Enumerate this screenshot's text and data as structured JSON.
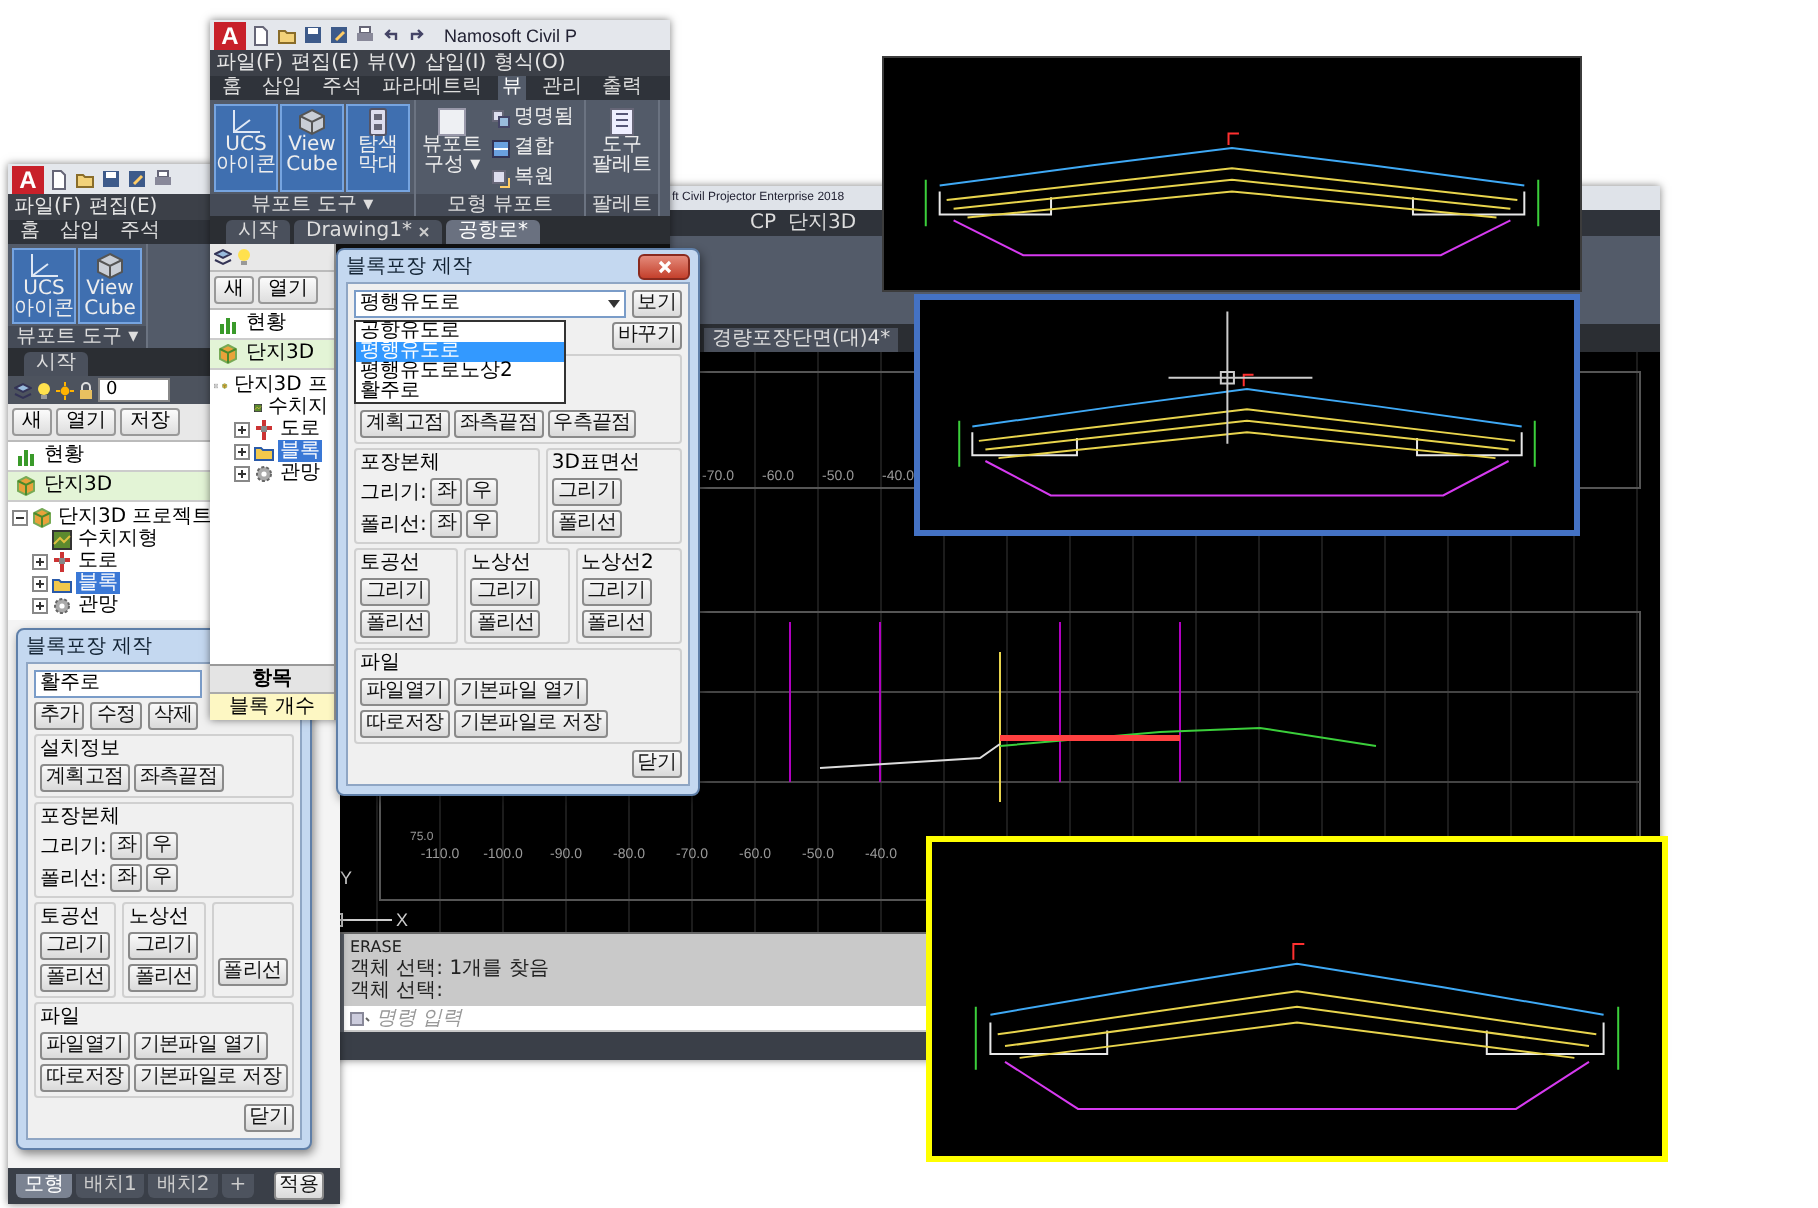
{
  "cad_window": {
    "title": "ft Civil Projector Enterprise 2018",
    "ribbon_tabs": [
      "CP",
      "단지3D"
    ],
    "file_tab": "경량포장단면(대)4*",
    "top_scale_labels": [
      "-70.0",
      "-60.0",
      "-50.0",
      "-40.0"
    ],
    "bottom_scale_labels": [
      "-110.0",
      "-100.0",
      "-90.0",
      "-80.0",
      "-70.0",
      "-60.0",
      "-50.0",
      "-40.0"
    ],
    "elevation": "75.0",
    "ucs": [
      "Y",
      "X"
    ],
    "command_history": [
      "ERASE",
      "객체 선택: 1개를 찾음",
      "객체 선택:"
    ],
    "command_placeholder": "명령 입력"
  },
  "left_window": {
    "logo": "A",
    "menu": [
      "파일(F)",
      "편집(E)"
    ],
    "tabs": [
      {
        "label": "홈",
        "selected": false
      },
      {
        "label": "삽입",
        "selected": false
      },
      {
        "label": "주석",
        "selected": false
      }
    ],
    "ribbon_panels": [
      {
        "label": "뷰포트 도구 ▾",
        "buttons": [
          {
            "kind": "ucs",
            "label": "UCS 아이콘",
            "selected": true
          },
          {
            "kind": "viewcube",
            "label": "View Cube",
            "selected": true
          }
        ]
      }
    ],
    "doc_tab": "시작",
    "layer": "0",
    "toolbar": [
      "새",
      "열기",
      "저장"
    ],
    "status": "현황",
    "project": "단지3D",
    "tree": [
      {
        "kind": "project",
        "label": "단지3D 프로젝트",
        "expanded": true,
        "selected": false,
        "children": [
          {
            "kind": "terrain",
            "label": "수치지형",
            "selected": false
          },
          {
            "kind": "road",
            "label": "도로",
            "expanded": false,
            "selected": false
          },
          {
            "kind": "block",
            "label": "블록",
            "expanded": false,
            "selected": true
          },
          {
            "kind": "network",
            "label": "관망",
            "expanded": false,
            "selected": false
          }
        ]
      }
    ],
    "dialog": {
      "title": "블록포장 제작",
      "dropdown": {
        "value": "활주로"
      },
      "edit_buttons": [
        "추가",
        "수정",
        "삭제"
      ],
      "sections": [
        {
          "groups": [
            {
              "title": "설치정보",
              "rows": [
                {
                  "buttons": [
                    "계획고점",
                    "좌측끝점"
                  ]
                }
              ]
            }
          ]
        },
        {
          "groups": [
            {
              "title": "포장본체",
              "rows": [
                {
                  "label": "그리기:",
                  "buttons": [
                    "좌",
                    "우"
                  ]
                },
                {
                  "label": "폴리선:",
                  "buttons": [
                    "좌",
                    "우"
                  ]
                }
              ]
            }
          ]
        },
        {
          "groups": [
            {
              "title": "토공선",
              "rows": [
                {
                  "buttons": [
                    "그리기"
                  ]
                },
                {
                  "buttons": [
                    "폴리선"
                  ]
                }
              ]
            },
            {
              "title": "노상선",
              "rows": [
                {
                  "buttons": [
                    "그리기"
                  ]
                },
                {
                  "buttons": [
                    "폴리선"
                  ]
                }
              ]
            },
            {
              "rows": [
                {
                  "buttons": [
                    "폴리선"
                  ]
                }
              ]
            }
          ]
        },
        {
          "groups": [
            {
              "title": "파일",
              "rows": [
                {
                  "buttons": [
                    "파일열기",
                    "기본파일 열기"
                  ]
                },
                {
                  "buttons": [
                    "따로저장",
                    "기본파일로 저장"
                  ]
                }
              ]
            }
          ]
        }
      ],
      "close": "닫기"
    },
    "apply": "적용",
    "layout_tabs": [
      {
        "label": "모형",
        "selected": true
      },
      {
        "label": "배치1",
        "selected": false
      },
      {
        "label": "배치2",
        "selected": false
      },
      {
        "label": "+",
        "selected": false
      }
    ]
  },
  "main_window": {
    "logo": "A",
    "title": "Namosoft Civil P",
    "menu": [
      "파일(F)",
      "편집(E)",
      "뷰(V)",
      "삽입(I)",
      "형식(O)"
    ],
    "tabs": [
      {
        "label": "홈",
        "selected": false
      },
      {
        "label": "삽입",
        "selected": false
      },
      {
        "label": "주석",
        "selected": false
      },
      {
        "label": "파라메트릭",
        "selected": false
      },
      {
        "label": "뷰",
        "selected": true
      },
      {
        "label": "관리",
        "selected": false
      },
      {
        "label": "출력",
        "selected": false
      }
    ],
    "ribbon_panels": [
      {
        "label": "뷰포트 도구 ▾",
        "buttons": [
          {
            "kind": "ucs",
            "label": "UCS 아이콘",
            "selected": true
          },
          {
            "kind": "viewcube",
            "label": "View Cube",
            "selected": true
          },
          {
            "kind": "navbar",
            "label": "탐색 막대",
            "selected": true
          }
        ]
      },
      {
        "label": "모형 뷰포트",
        "buttons": [
          {
            "kind": "viewport",
            "label": "뷰포트 구성 ▾",
            "selected": false
          },
          {
            "kind": "named",
            "label": "명명됨",
            "selected": false
          },
          {
            "kind": "join",
            "label": "결합",
            "selected": false
          },
          {
            "kind": "restore",
            "label": "복원",
            "selected": false
          }
        ]
      },
      {
        "label": "팔레트",
        "buttons": [
          {
            "kind": "palette",
            "label": "도구 팔레트",
            "selected": false
          }
        ]
      }
    ],
    "doc_tabs": [
      {
        "label": "시작",
        "selected": false,
        "closable": false
      },
      {
        "label": "Drawing1*",
        "selected": false,
        "closable": true
      },
      {
        "label": "공항로*",
        "selected": true,
        "closable": false
      }
    ],
    "toolbar": [
      "새",
      "열기"
    ],
    "status": "현황",
    "project": "단지3D",
    "tree": [
      {
        "kind": "project",
        "label": "단지3D 프",
        "expanded": true,
        "selected": false,
        "children": [
          {
            "kind": "terrain",
            "label": "수치지",
            "selected": false
          },
          {
            "kind": "road",
            "label": "도로",
            "expanded": false,
            "selected": false
          },
          {
            "kind": "block",
            "label": "블록",
            "expanded": false,
            "selected": true
          },
          {
            "kind": "network",
            "label": "관망",
            "expanded": false,
            "selected": false
          }
        ]
      }
    ],
    "table": {
      "header": "항목",
      "cell": "블록 개수"
    }
  },
  "dialog": {
    "title": "블록포장 제작",
    "dropdown": {
      "value": "평행유도로",
      "options": [
        {
          "label": "공항유도로",
          "selected": false
        },
        {
          "label": "평행유도로",
          "selected": true
        },
        {
          "label": "평행유도로노상2",
          "selected": false
        },
        {
          "label": "활주로",
          "selected": false
        }
      ]
    },
    "view_button": "보기",
    "edit_buttons": [
      "바꾸기"
    ],
    "sections": [
      {
        "groups": [
          {
            "rows": [
              {
                "buttons": [
                  "계획고점",
                  "좌측끝점",
                  "우측끝점"
                ]
              }
            ]
          }
        ]
      },
      {
        "groups": [
          {
            "title": "포장본체",
            "rows": [
              {
                "label": "그리기:",
                "buttons": [
                  "좌",
                  "우"
                ]
              },
              {
                "label": "폴리선:",
                "buttons": [
                  "좌",
                  "우"
                ]
              }
            ]
          },
          {
            "title": "3D표면선",
            "rows": [
              {
                "buttons": [
                  "그리기"
                ]
              },
              {
                "buttons": [
                  "폴리선"
                ]
              }
            ]
          }
        ]
      },
      {
        "groups": [
          {
            "title": "토공선",
            "rows": [
              {
                "buttons": [
                  "그리기"
                ]
              },
              {
                "buttons": [
                  "폴리선"
                ]
              }
            ]
          },
          {
            "title": "노상선",
            "rows": [
              {
                "buttons": [
                  "그리기"
                ]
              },
              {
                "buttons": [
                  "폴리선"
                ]
              }
            ]
          },
          {
            "title": "노상선2",
            "rows": [
              {
                "buttons": [
                  "그리기"
                ]
              },
              {
                "buttons": [
                  "폴리선"
                ]
              }
            ]
          }
        ]
      },
      {
        "groups": [
          {
            "title": "파일",
            "rows": [
              {
                "buttons": [
                  "파일열기",
                  "기본파일 열기"
                ]
              },
              {
                "buttons": [
                  "따로저장",
                  "기본파일로 저장"
                ]
              }
            ]
          }
        ]
      }
    ],
    "close": "닫기"
  },
  "images": [
    {
      "color": "#3c3c3c",
      "crosshair": false
    },
    {
      "color": "#4472c4",
      "crosshair": true
    },
    {
      "color": "#ffff00",
      "crosshair": false
    }
  ]
}
